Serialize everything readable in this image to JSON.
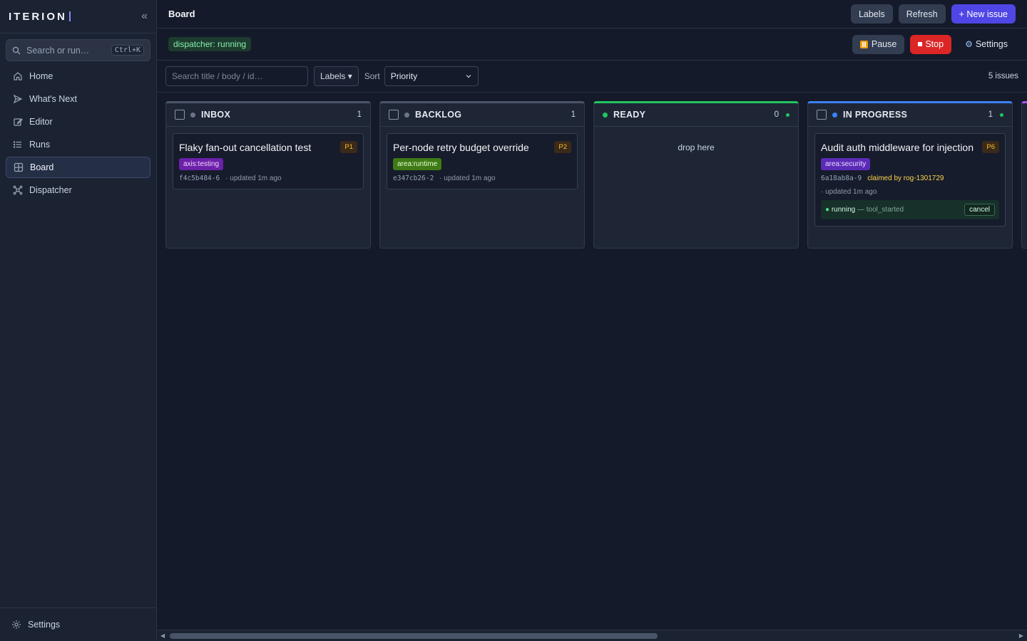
{
  "app": {
    "brand": "ITERION"
  },
  "sidebar": {
    "search": {
      "placeholder": "Search or run…",
      "shortcut": "Ctrl+K"
    },
    "items": [
      {
        "label": "Home",
        "icon": "home-icon"
      },
      {
        "label": "What's Next",
        "icon": "send-icon"
      },
      {
        "label": "Editor",
        "icon": "edit-icon"
      },
      {
        "label": "Runs",
        "icon": "list-icon"
      },
      {
        "label": "Board",
        "icon": "grid-icon",
        "active": true
      },
      {
        "label": "Dispatcher",
        "icon": "hub-icon"
      }
    ],
    "footer": {
      "label": "Settings"
    }
  },
  "header": {
    "title": "Board",
    "labels_btn": "Labels",
    "refresh_btn": "Refresh",
    "new_issue_btn": "+ New issue"
  },
  "dispatcher": {
    "status": "dispatcher: running",
    "pause_btn": "Pause",
    "stop_btn": "Stop",
    "settings_btn": "Settings"
  },
  "filters": {
    "search_placeholder": "Search title / body / id…",
    "labels_dd": "Labels ▾",
    "sort_label": "Sort",
    "sort_value": "Priority",
    "issue_count": "5 issues"
  },
  "columns": {
    "inbox": {
      "title": "INBOX",
      "count": "1",
      "card": {
        "title": "Flaky fan-out cancellation test",
        "priority": "P1",
        "tag": "axis:testing",
        "id": "f4c5b484-6",
        "updated": "· updated 1m ago"
      }
    },
    "backlog": {
      "title": "BACKLOG",
      "count": "1",
      "card": {
        "title": "Per-node retry budget override",
        "priority": "P2",
        "tag": "area:runtime",
        "id": "e347cb26-2",
        "updated": "· updated 1m ago"
      }
    },
    "ready": {
      "title": "READY",
      "count": "0",
      "empty": "drop here"
    },
    "in_progress": {
      "title": "IN PROGRESS",
      "count": "1",
      "card": {
        "title": "Audit auth middleware for injection",
        "priority": "P6",
        "tag": "area:security",
        "id": "6a18ab8a-9",
        "claimed": "claimed by rog-1301729",
        "updated": "· updated 1m ago",
        "run_state": "running",
        "run_event": "— tool_started",
        "cancel": "cancel"
      }
    }
  },
  "colors": {
    "accent": "#4f46e5",
    "stop": "#dc2626",
    "ready": "#22c55e",
    "progress": "#3b82f6"
  }
}
